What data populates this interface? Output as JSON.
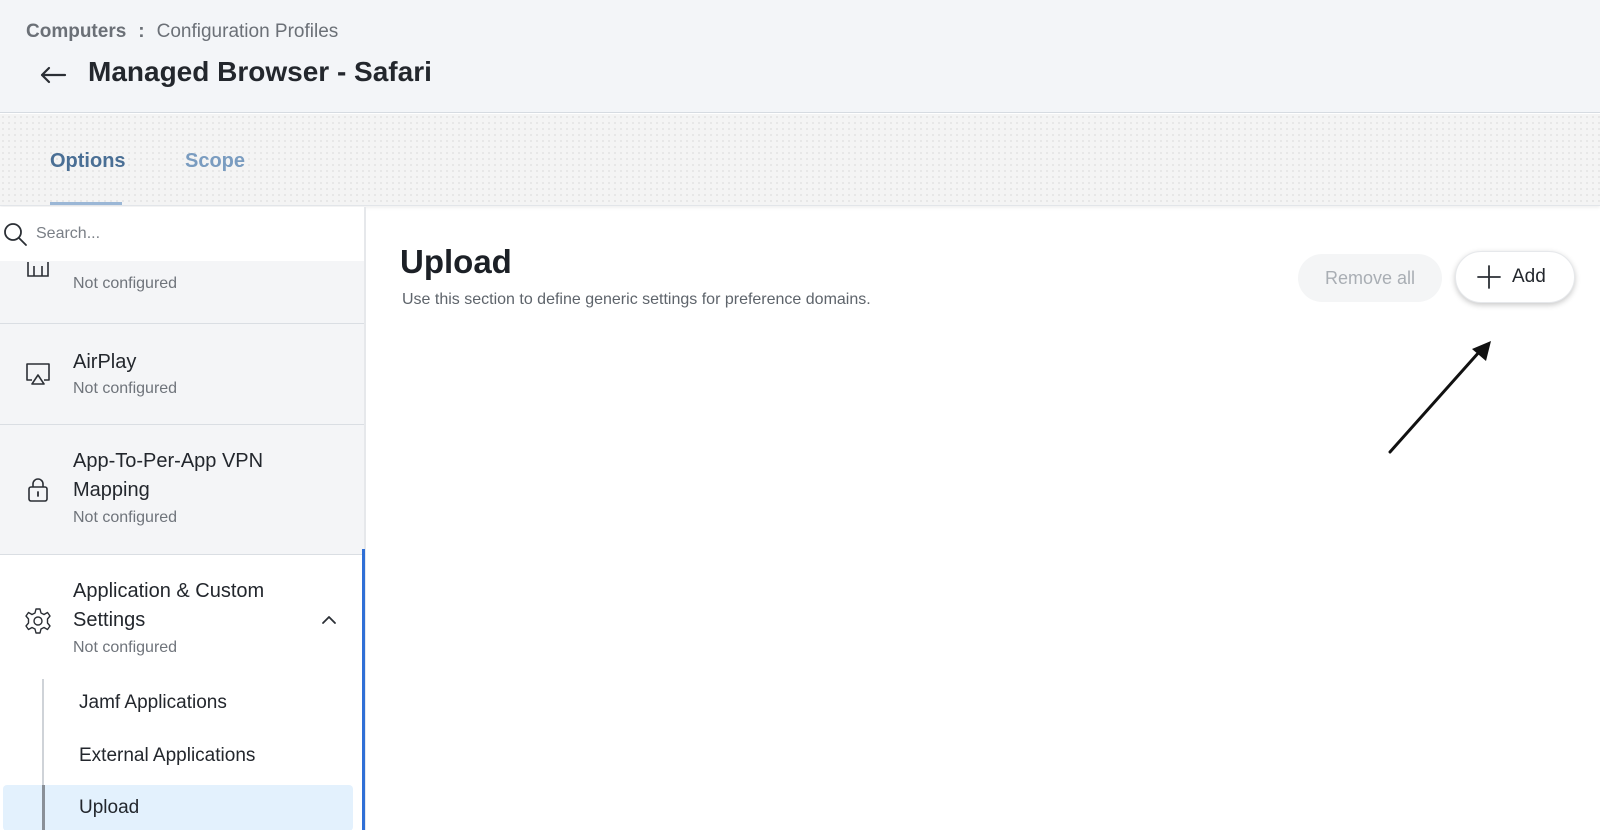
{
  "breadcrumb": {
    "parent": "Computers",
    "separator": ":",
    "current": "Configuration Profiles"
  },
  "page": {
    "title": "Managed Browser - Safari"
  },
  "tabs": [
    {
      "label": "Options",
      "active": true
    },
    {
      "label": "Scope",
      "active": false
    }
  ],
  "sidebar": {
    "search_placeholder": "Search...",
    "items": [
      {
        "label": "",
        "status": "Not configured",
        "icon": "partial-icon"
      },
      {
        "label": "AirPlay",
        "status": "Not configured",
        "icon": "airplay-icon"
      },
      {
        "label": "App-To-Per-App VPN Mapping",
        "status": "Not configured",
        "icon": "lock-icon"
      },
      {
        "label": "Application & Custom Settings",
        "status": "Not configured",
        "icon": "gear-icon",
        "expanded": true
      }
    ],
    "sub_items": [
      {
        "label": "Jamf Applications"
      },
      {
        "label": "External Applications"
      },
      {
        "label": "Upload",
        "selected": true
      }
    ]
  },
  "main": {
    "title": "Upload",
    "description": "Use this section to define generic settings for preference domains.",
    "remove_all_label": "Remove all",
    "add_label": "Add"
  },
  "colors": {
    "accent": "#2f6fd6",
    "selected_bg": "#e3f1fd",
    "tab_active": "#4a6f95"
  }
}
